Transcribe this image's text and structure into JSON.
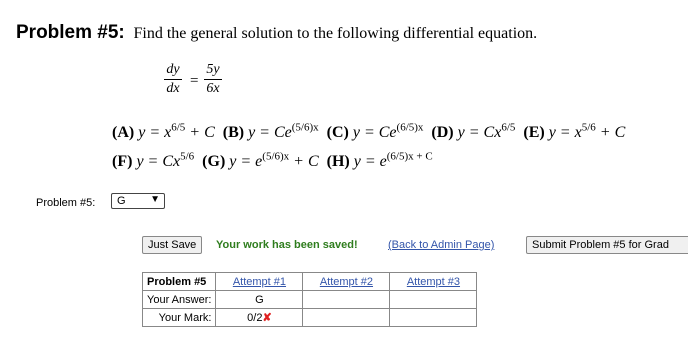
{
  "problem": {
    "heading": "Problem #5:",
    "text": "Find the general solution to the following differential equation.",
    "equation": {
      "lhs_num": "dy",
      "lhs_den": "dx",
      "eq": "=",
      "rhs_num": "5y",
      "rhs_den": "6x"
    },
    "choices_row1": [
      {
        "label": "(A)",
        "pre": "y = x",
        "sup": "6/5",
        "post": " + C"
      },
      {
        "label": "(B)",
        "pre": "y = Ce",
        "sup": "(5/6)x",
        "post": ""
      },
      {
        "label": "(C)",
        "pre": "y = Ce",
        "sup": "(6/5)x",
        "post": ""
      },
      {
        "label": "(D)",
        "pre": "y = Cx",
        "sup": "6/5",
        "post": ""
      },
      {
        "label": "(E)",
        "pre": "y = x",
        "sup": "5/6",
        "post": " + C"
      }
    ],
    "choices_row2": [
      {
        "label": "(F)",
        "pre": "y = Cx",
        "sup": "5/6",
        "post": ""
      },
      {
        "label": "(G)",
        "pre": "y = e",
        "sup": "(5/6)x",
        "post": " + C"
      },
      {
        "label": "(H)",
        "pre": "y = e",
        "sup": "(6/5)x + C",
        "post": ""
      }
    ]
  },
  "answer": {
    "label": "Problem #5:",
    "selected": "G"
  },
  "actions": {
    "save": "Just Save",
    "saved_msg": "Your work has been saved!",
    "admin_link": "(Back to Admin Page)",
    "submit": "Submit Problem #5 for Grad"
  },
  "results": {
    "header": "Problem #5",
    "attempts": [
      "Attempt #1",
      "Attempt #2",
      "Attempt #3"
    ],
    "answer_label": "Your Answer:",
    "mark_label": "Your Mark:",
    "answers": [
      "G",
      "",
      ""
    ],
    "marks": [
      "0/2",
      "",
      ""
    ],
    "mark_icon": "✘"
  }
}
